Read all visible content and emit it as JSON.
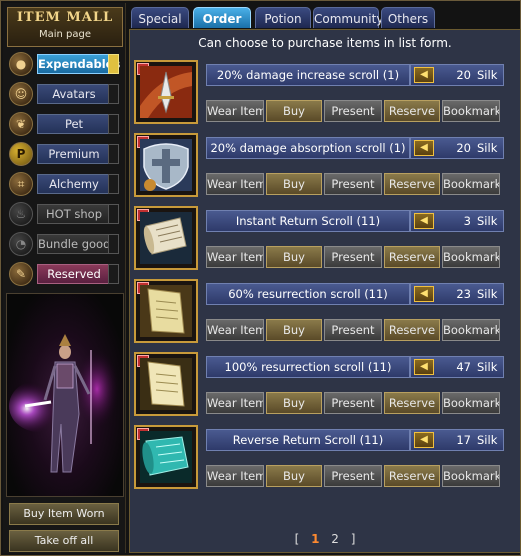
{
  "mall": {
    "title": "ITEM MALL",
    "subtitle": "Main page"
  },
  "categories": [
    {
      "label": "Expendables"
    },
    {
      "label": "Avatars"
    },
    {
      "label": "Pet"
    },
    {
      "label": "Premium"
    },
    {
      "label": "Alchemy"
    },
    {
      "label": "HOT shop"
    },
    {
      "label": "Bundle goods"
    },
    {
      "label": "Reserved"
    }
  ],
  "left_buttons": {
    "buy_worn": "Buy Item Worn",
    "take_off": "Take off all"
  },
  "tabs": [
    {
      "label": "Special"
    },
    {
      "label": "Order"
    },
    {
      "label": "Potion"
    },
    {
      "label": "Community"
    },
    {
      "label": "Others"
    }
  ],
  "notice": "Can choose to purchase items in list form.",
  "actions": {
    "wear": "Wear Item",
    "buy": "Buy",
    "present": "Present",
    "reserve": "Reserve",
    "bookmark": "Bookmark"
  },
  "items": [
    {
      "name": "20% damage increase scroll (1)",
      "price": "20",
      "currency": "Silk"
    },
    {
      "name": "20% damage absorption scroll (1)",
      "price": "20",
      "currency": "Silk"
    },
    {
      "name": "Instant Return Scroll (11)",
      "price": "3",
      "currency": "Silk"
    },
    {
      "name": "60% resurrection scroll (11)",
      "price": "23",
      "currency": "Silk"
    },
    {
      "name": "100% resurrection scroll (11)",
      "price": "47",
      "currency": "Silk"
    },
    {
      "name": "Reverse Return Scroll (11)",
      "price": "17",
      "currency": "Silk"
    }
  ],
  "pager": {
    "open": "[",
    "pages": [
      "1",
      "2"
    ],
    "close": "]"
  }
}
